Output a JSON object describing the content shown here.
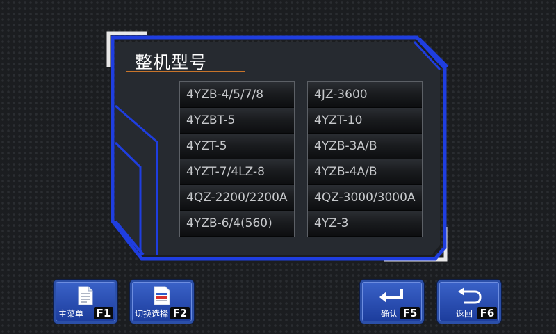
{
  "panel": {
    "title": "整机型号"
  },
  "models": {
    "left": [
      "4YZB-4/5/7/8",
      "4YZBT-5",
      "4YZT-5",
      "4YZT-7/4LZ-8",
      "4QZ-2200/2200A",
      "4YZB-6/4(560)"
    ],
    "right": [
      "4JZ-3600",
      "4YZT-10",
      "4YZB-3A/B",
      "4YZB-4A/B",
      "4QZ-3000/3000A",
      "4YZ-3"
    ]
  },
  "function_keys": [
    {
      "label": "主菜单",
      "key": "F1",
      "icon": "document-icon"
    },
    {
      "label": "切换选择",
      "key": "F2",
      "icon": "document-list-icon"
    },
    {
      "label": "确认",
      "key": "F5",
      "icon": "enter-arrow-icon"
    },
    {
      "label": "返回",
      "key": "F6",
      "icon": "return-arrow-icon"
    }
  ],
  "colors": {
    "frame_blue": "#1f3ee0",
    "panel_bg": "#262a30",
    "title_underline": "#c8742a",
    "key_blue": "#2b52c4"
  }
}
